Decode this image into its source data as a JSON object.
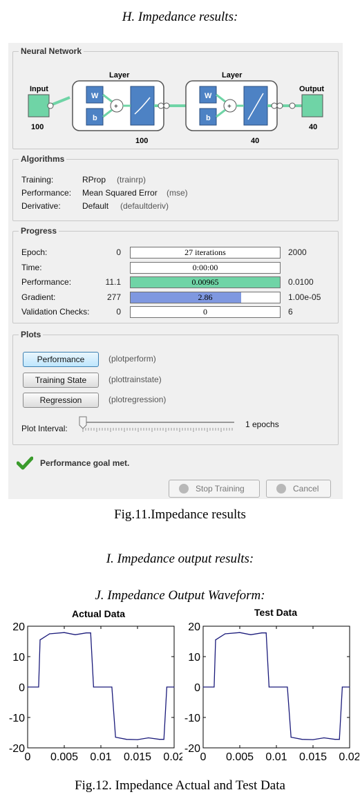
{
  "headings": {
    "h": "H. Impedance results:",
    "i": "I. Impedance output results:",
    "j": "J. Impedance Output Waveform:"
  },
  "captions": {
    "fig11": "Fig.11.Impedance results",
    "fig12": "Fig.12. Impedance Actual and Test Data"
  },
  "nntool": {
    "network": {
      "title": "Neural Network",
      "input_label": "Input",
      "input_size": "100",
      "output_label": "Output",
      "output_size": "40",
      "layers": [
        {
          "label": "Layer",
          "size": "100",
          "w": "W",
          "b": "b",
          "plus": "+"
        },
        {
          "label": "Layer",
          "size": "40",
          "w": "W",
          "b": "b",
          "plus": "+"
        }
      ]
    },
    "algorithms": {
      "title": "Algorithms",
      "rows": [
        {
          "label": "Training:",
          "value": "RProp",
          "sub": "(trainrp)"
        },
        {
          "label": "Performance:",
          "value": "Mean Squared Error",
          "sub": "(mse)"
        },
        {
          "label": "Derivative:",
          "value": "Default",
          "sub": "(defaultderiv)"
        }
      ]
    },
    "progress": {
      "title": "Progress",
      "rows": [
        {
          "label": "Epoch:",
          "start": "0",
          "value": "27 iterations",
          "end": "2000",
          "fill": 0.01,
          "color": "#ffffff"
        },
        {
          "label": "Time:",
          "start": "",
          "value": "0:00:00",
          "end": "",
          "fill": 0,
          "color": "#ffffff"
        },
        {
          "label": "Performance:",
          "start": "11.1",
          "value": "0.00965",
          "end": "0.0100",
          "fill": 1.0,
          "color": "#6fd4a6"
        },
        {
          "label": "Gradient:",
          "start": "277",
          "value": "2.86",
          "end": "1.00e-05",
          "fill": 0.74,
          "color": "#7f98e0"
        },
        {
          "label": "Validation Checks:",
          "start": "0",
          "value": "0",
          "end": "6",
          "fill": 0,
          "color": "#ffffff"
        }
      ]
    },
    "plots": {
      "title": "Plots",
      "buttons": [
        {
          "label": "Performance",
          "sub": "(plotperform)"
        },
        {
          "label": "Training State",
          "sub": "(plottrainstate)"
        },
        {
          "label": "Regression",
          "sub": "(plotregression)"
        }
      ],
      "interval_label": "Plot Interval:",
      "interval_value": "1 epochs"
    },
    "status": {
      "icon": "checkmark-icon",
      "text": "Performance goal met."
    },
    "actions": {
      "stop": "Stop Training",
      "cancel": "Cancel"
    }
  },
  "chart_data": [
    {
      "type": "line",
      "title": "Actual Data",
      "xlim": [
        0,
        0.02
      ],
      "ylim": [
        -20,
        20
      ],
      "xticks": [
        "0",
        "0.005",
        "0.01",
        "0.015",
        "0.02"
      ],
      "yticks": [
        "20",
        "10",
        "0",
        "-10",
        "-20"
      ],
      "line_color": "#1a1a7a",
      "x": [
        0,
        0.0015,
        0.0017,
        0.003,
        0.005,
        0.0065,
        0.008,
        0.0086,
        0.009,
        0.0115,
        0.012,
        0.0135,
        0.015,
        0.0165,
        0.018,
        0.0186,
        0.019,
        0.02
      ],
      "y": [
        0,
        0,
        15.5,
        17.5,
        17.9,
        17.2,
        17.8,
        17.8,
        0,
        0,
        -16.5,
        -17.2,
        -17.3,
        -16.7,
        -17.2,
        -17.2,
        0,
        0
      ]
    },
    {
      "type": "line",
      "title": "Test Data",
      "xlim": [
        0,
        0.02
      ],
      "ylim": [
        -20,
        20
      ],
      "xticks": [
        "0",
        "0.005",
        "0.01",
        "0.015",
        "0.02"
      ],
      "yticks": [
        "20",
        "10",
        "0",
        "-10",
        "-20"
      ],
      "line_color": "#1a1a7a",
      "x": [
        0,
        0.0015,
        0.0017,
        0.003,
        0.005,
        0.0065,
        0.008,
        0.0086,
        0.009,
        0.0115,
        0.012,
        0.0135,
        0.015,
        0.0165,
        0.018,
        0.0186,
        0.019,
        0.02
      ],
      "y": [
        0,
        0,
        15.5,
        17.5,
        17.9,
        17.2,
        17.8,
        17.8,
        0,
        0,
        -16.5,
        -17.2,
        -17.3,
        -16.7,
        -17.2,
        -17.2,
        0,
        0
      ]
    }
  ]
}
